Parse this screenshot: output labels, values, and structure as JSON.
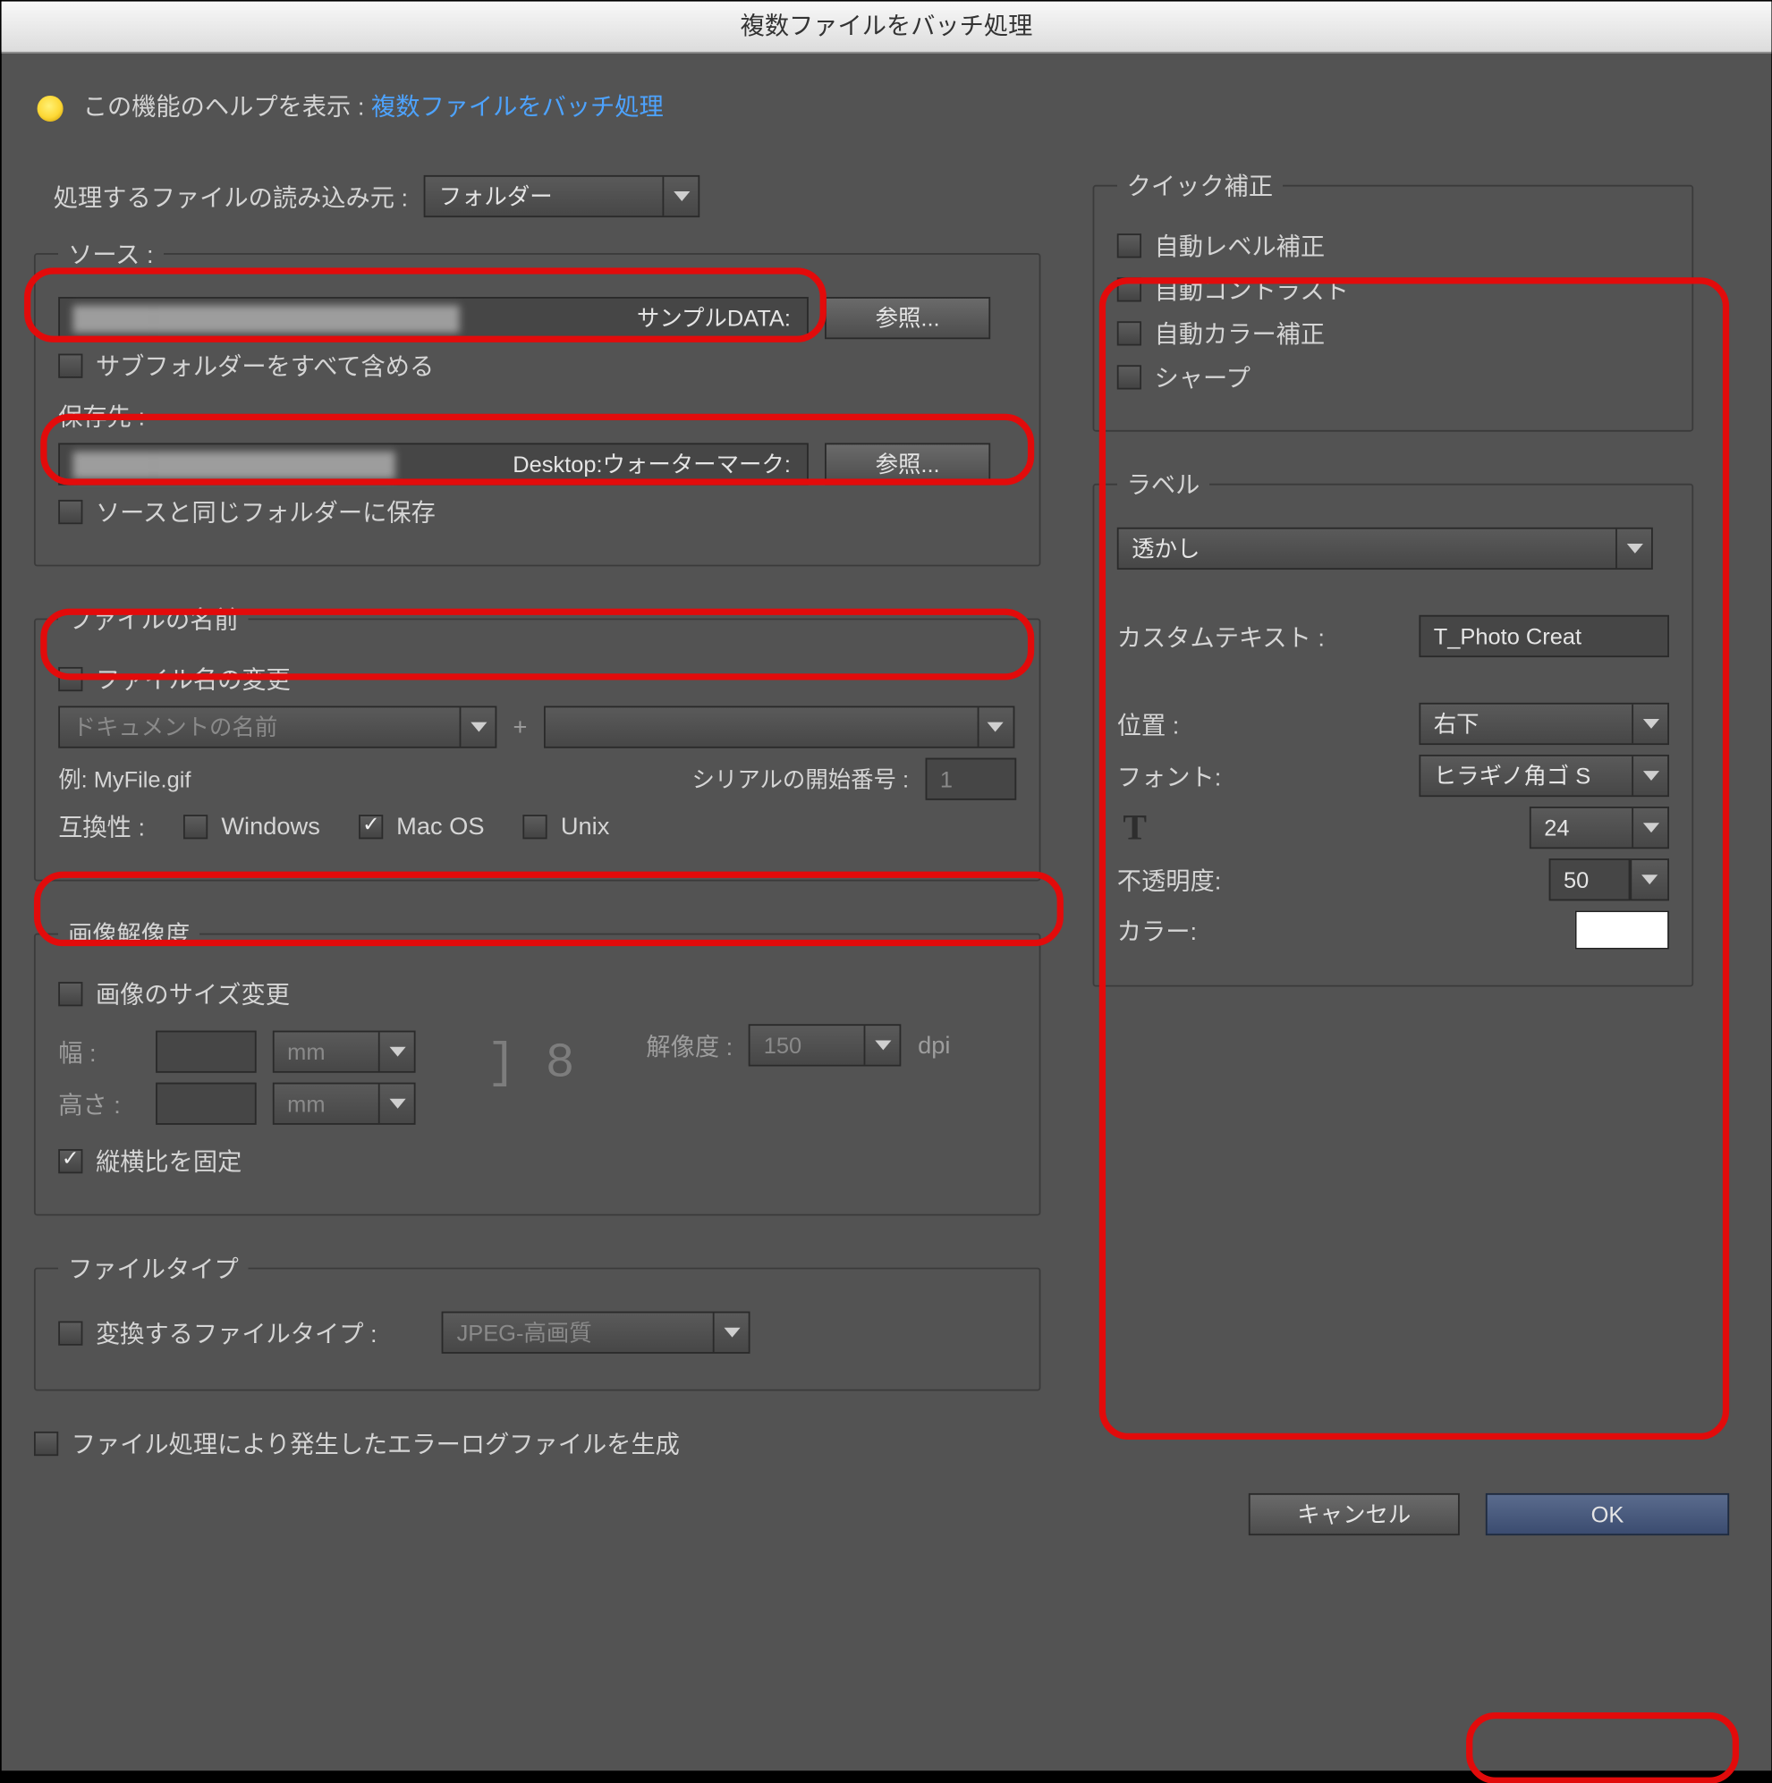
{
  "title": "複数ファイルをバッチ処理",
  "help": {
    "prefix": "この機能のヘルプを表示 :",
    "link": "複数ファイルをバッチ処理"
  },
  "source": {
    "processFromLabel": "処理するファイルの読み込み元 :",
    "processFromValue": "フォルダー",
    "sourceLabel": "ソース :",
    "sourcePathSuffix": "サンプルDATA:",
    "browse": "参照...",
    "includeSubfolders": "サブフォルダーをすべて含める",
    "saveToLabel": "保存先 :",
    "saveToPathSuffix": "Desktop:ウォーターマーク:",
    "sameAsSource": "ソースと同じフォルダーに保存"
  },
  "filename": {
    "legend": "ファイルの名前",
    "rename": "ファイル名の変更",
    "token1": "ドキュメントの名前",
    "plus": "+",
    "example": "例: MyFile.gif",
    "serialLabel": "シリアルの開始番号 :",
    "serialValue": "1",
    "compatLabel": "互換性 :",
    "compatWindows": "Windows",
    "compatMac": "Mac OS",
    "compatUnix": "Unix"
  },
  "imageSize": {
    "legend": "画像解像度",
    "resize": "画像のサイズ変更",
    "widthLabel": "幅 :",
    "heightLabel": "高さ :",
    "unit": "mm",
    "resLabel": "解像度 :",
    "resValue": "150",
    "resUnit": "dpi",
    "constrain": "縦横比を固定"
  },
  "filetype": {
    "legend": "ファイルタイプ",
    "convertLabel": "変換するファイルタイプ :",
    "value": "JPEG-高画質"
  },
  "errorLog": "ファイル処理により発生したエラーログファイルを生成",
  "quickfix": {
    "legend": "クイック補正",
    "autoLevels": "自動レベル補正",
    "autoContrast": "自動コントラスト",
    "autoColor": "自動カラー補正",
    "sharpen": "シャープ"
  },
  "label": {
    "legend": "ラベル",
    "type": "透かし",
    "customTextLabel": "カスタムテキスト :",
    "customTextValue": "T_Photo Creat",
    "positionLabel": "位置 :",
    "positionValue": "右下",
    "fontLabel": "フォント:",
    "fontValue": "ヒラギノ角ゴ S",
    "sizeValue": "24",
    "opacityLabel": "不透明度:",
    "opacityValue": "50",
    "colorLabel": "カラー:",
    "colorValue": "#ffffff"
  },
  "buttons": {
    "cancel": "キャンセル",
    "ok": "OK"
  }
}
